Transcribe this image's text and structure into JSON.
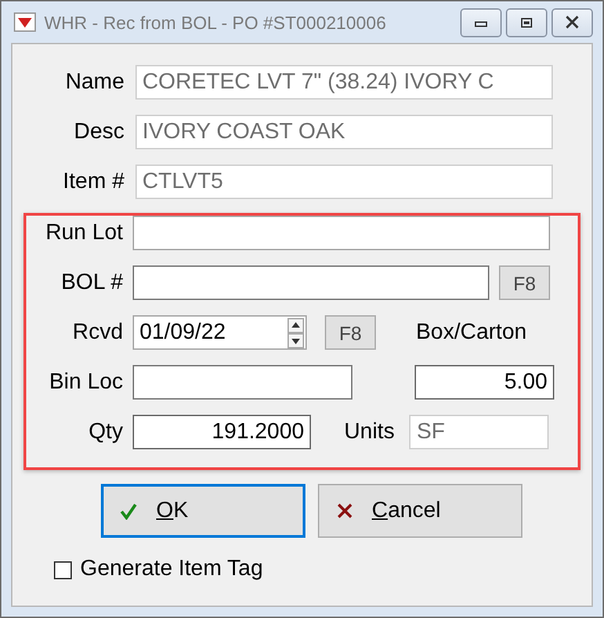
{
  "window": {
    "title": "WHR - Rec from BOL - PO #ST000210006"
  },
  "item_fields": [
    {
      "label": "Name",
      "value": "CORETEC LVT 7\" (38.24) IVORY C",
      "disabled": true
    },
    {
      "label": "Desc",
      "value": "IVORY COAST OAK",
      "disabled": true
    },
    {
      "label": "Item #",
      "value": "CTLVT5",
      "disabled": true
    }
  ],
  "receiving": {
    "run_lot": {
      "label": "Run Lot"
    },
    "bol": {
      "label": "BOL #",
      "button": "F8"
    },
    "rcvd": {
      "label": "Rcvd",
      "value": "01/09/22",
      "button": "F8"
    },
    "box_carton": {
      "label": "Box/Carton",
      "value": "5.00"
    },
    "bin_loc": {
      "label": "Bin Loc"
    },
    "qty": {
      "label": "Qty",
      "value": "191.2000"
    },
    "units": {
      "label": "Units",
      "value": "SF",
      "disabled": true
    }
  },
  "buttons": [
    {
      "label": "OK",
      "kind": "ok",
      "focused": true
    },
    {
      "label": "Cancel",
      "kind": "cancel",
      "focused": false
    }
  ],
  "generate_item_tag": {
    "label": "Generate Item Tag",
    "checked": false
  }
}
